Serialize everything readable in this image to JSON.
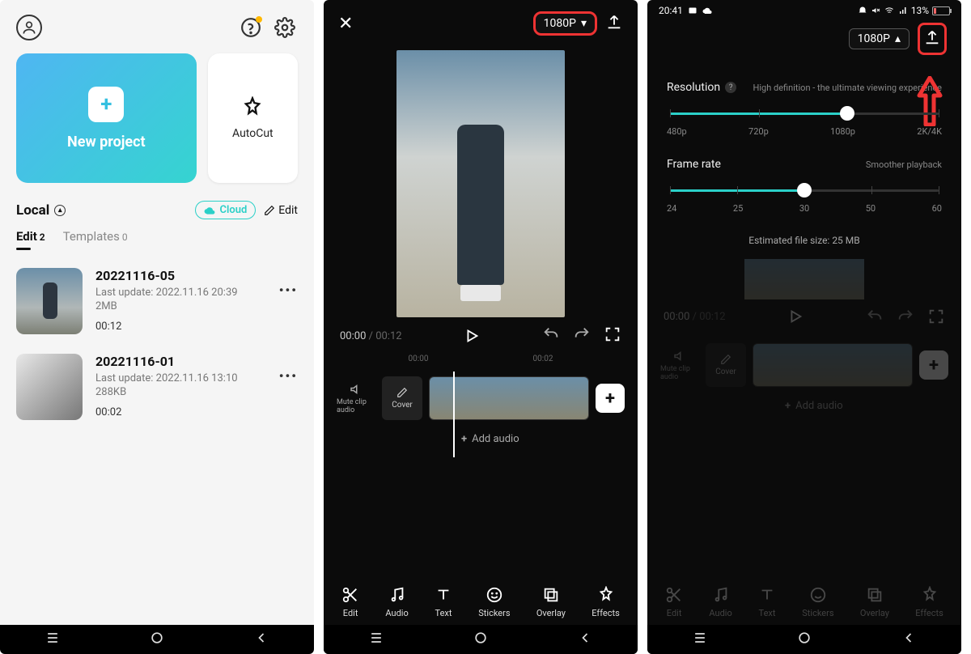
{
  "screen1": {
    "new_project_label": "New project",
    "autocut_label": "AutoCut",
    "local_label": "Local",
    "cloud_chip_label": "Cloud",
    "edit_link_label": "Edit",
    "tabs": {
      "edit_label": "Edit",
      "edit_count": "2",
      "templates_label": "Templates",
      "templates_count": "0"
    },
    "projects": [
      {
        "title": "20221116-05",
        "last_update": "Last update: 2022.11.16 20:39",
        "size": "2MB",
        "duration": "00:12"
      },
      {
        "title": "20221116-01",
        "last_update": "Last update: 2022.11.16 13:10",
        "size": "288KB",
        "duration": "00:02"
      }
    ]
  },
  "screen2": {
    "resolution_label": "1080P",
    "time_current": "00:00",
    "time_total": " / 00:12",
    "tick_left": "00:00",
    "tick_right": "00:02",
    "mute_label": "Mute clip audio",
    "cover_label": "Cover",
    "add_audio_label": "Add audio",
    "tools": {
      "edit": "Edit",
      "audio": "Audio",
      "text": "Text",
      "stickers": "Stickers",
      "overlay": "Overlay",
      "effects": "Effects"
    }
  },
  "screen3": {
    "status_time": "20:41",
    "battery_pct": "13%",
    "resolution_label": "1080P",
    "resolution": {
      "label": "Resolution",
      "desc": "High definition - the ultimate viewing experience",
      "marks": [
        "480p",
        "720p",
        "1080p",
        "2K/4K"
      ],
      "fill_pct": 66
    },
    "framerate": {
      "label": "Frame rate",
      "desc": "Smoother playback",
      "marks": [
        "24",
        "25",
        "30",
        "50",
        "60"
      ],
      "fill_pct": 50
    },
    "est_size": "Estimated file size: 25 MB",
    "bg": {
      "time_current": "00:00",
      "time_total": " / 00:12",
      "mute_label": "Mute clip audio",
      "cover_label": "Cover",
      "add_audio_label": "Add audio"
    },
    "tools": {
      "edit": "Edit",
      "audio": "Audio",
      "text": "Text",
      "stickers": "Stickers",
      "overlay": "Overlay",
      "effects": "Effects"
    }
  }
}
